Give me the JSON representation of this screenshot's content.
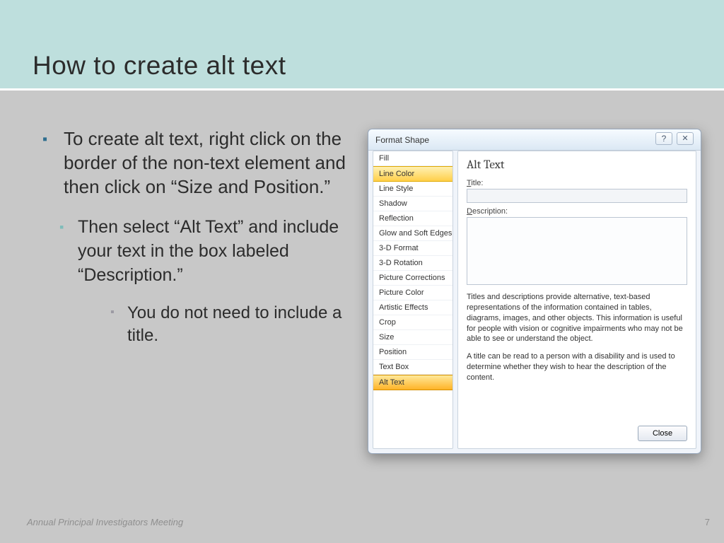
{
  "slide": {
    "title": "How to create alt text",
    "bullets": {
      "b1": "To create alt text, right click on the border of the non-text element and then click on “Size and Position.”",
      "b2": "Then select “Alt Text” and include your text in the box labeled “Description.”",
      "b3": "You do not need to include a title."
    },
    "footer": "Annual Principal Investigators Meeting",
    "page": "7"
  },
  "dialog": {
    "title": "Format Shape",
    "help_glyph": "?",
    "close_glyph": "✕",
    "categories": [
      "Fill",
      "Line Color",
      "Line Style",
      "Shadow",
      "Reflection",
      "Glow and Soft Edges",
      "3-D Format",
      "3-D Rotation",
      "Picture Corrections",
      "Picture Color",
      "Artistic Effects",
      "Crop",
      "Size",
      "Position",
      "Text Box",
      "Alt Text"
    ],
    "highlighted_index": 1,
    "selected_index": 15,
    "pane": {
      "heading": "Alt Text",
      "title_label_pre": "T",
      "title_label_rest": "itle:",
      "desc_label_pre": "D",
      "desc_label_rest": "escription:",
      "info1": "Titles and descriptions provide alternative, text-based representations of the information contained in tables, diagrams, images, and other objects. This information is useful for people with vision or cognitive impairments who may not be able to see or understand the object.",
      "info2": "A title can be read to a person with a disability and is used to determine whether they wish to hear the description of the content.",
      "close_button": "Close"
    }
  }
}
